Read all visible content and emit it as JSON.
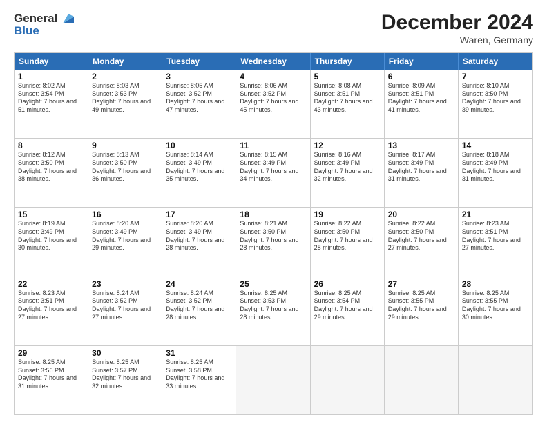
{
  "logo": {
    "line1": "General",
    "line2": "Blue"
  },
  "title": "December 2024",
  "location": "Waren, Germany",
  "header": {
    "days": [
      "Sunday",
      "Monday",
      "Tuesday",
      "Wednesday",
      "Thursday",
      "Friday",
      "Saturday"
    ]
  },
  "weeks": [
    [
      {
        "day": "1",
        "sunrise": "8:02 AM",
        "sunset": "3:54 PM",
        "daylight": "7 hours and 51 minutes."
      },
      {
        "day": "2",
        "sunrise": "8:03 AM",
        "sunset": "3:53 PM",
        "daylight": "7 hours and 49 minutes."
      },
      {
        "day": "3",
        "sunrise": "8:05 AM",
        "sunset": "3:52 PM",
        "daylight": "7 hours and 47 minutes."
      },
      {
        "day": "4",
        "sunrise": "8:06 AM",
        "sunset": "3:52 PM",
        "daylight": "7 hours and 45 minutes."
      },
      {
        "day": "5",
        "sunrise": "8:08 AM",
        "sunset": "3:51 PM",
        "daylight": "7 hours and 43 minutes."
      },
      {
        "day": "6",
        "sunrise": "8:09 AM",
        "sunset": "3:51 PM",
        "daylight": "7 hours and 41 minutes."
      },
      {
        "day": "7",
        "sunrise": "8:10 AM",
        "sunset": "3:50 PM",
        "daylight": "7 hours and 39 minutes."
      }
    ],
    [
      {
        "day": "8",
        "sunrise": "8:12 AM",
        "sunset": "3:50 PM",
        "daylight": "7 hours and 38 minutes."
      },
      {
        "day": "9",
        "sunrise": "8:13 AM",
        "sunset": "3:50 PM",
        "daylight": "7 hours and 36 minutes."
      },
      {
        "day": "10",
        "sunrise": "8:14 AM",
        "sunset": "3:49 PM",
        "daylight": "7 hours and 35 minutes."
      },
      {
        "day": "11",
        "sunrise": "8:15 AM",
        "sunset": "3:49 PM",
        "daylight": "7 hours and 34 minutes."
      },
      {
        "day": "12",
        "sunrise": "8:16 AM",
        "sunset": "3:49 PM",
        "daylight": "7 hours and 32 minutes."
      },
      {
        "day": "13",
        "sunrise": "8:17 AM",
        "sunset": "3:49 PM",
        "daylight": "7 hours and 31 minutes."
      },
      {
        "day": "14",
        "sunrise": "8:18 AM",
        "sunset": "3:49 PM",
        "daylight": "7 hours and 31 minutes."
      }
    ],
    [
      {
        "day": "15",
        "sunrise": "8:19 AM",
        "sunset": "3:49 PM",
        "daylight": "7 hours and 30 minutes."
      },
      {
        "day": "16",
        "sunrise": "8:20 AM",
        "sunset": "3:49 PM",
        "daylight": "7 hours and 29 minutes."
      },
      {
        "day": "17",
        "sunrise": "8:20 AM",
        "sunset": "3:49 PM",
        "daylight": "7 hours and 28 minutes."
      },
      {
        "day": "18",
        "sunrise": "8:21 AM",
        "sunset": "3:50 PM",
        "daylight": "7 hours and 28 minutes."
      },
      {
        "day": "19",
        "sunrise": "8:22 AM",
        "sunset": "3:50 PM",
        "daylight": "7 hours and 28 minutes."
      },
      {
        "day": "20",
        "sunrise": "8:22 AM",
        "sunset": "3:50 PM",
        "daylight": "7 hours and 27 minutes."
      },
      {
        "day": "21",
        "sunrise": "8:23 AM",
        "sunset": "3:51 PM",
        "daylight": "7 hours and 27 minutes."
      }
    ],
    [
      {
        "day": "22",
        "sunrise": "8:23 AM",
        "sunset": "3:51 PM",
        "daylight": "7 hours and 27 minutes."
      },
      {
        "day": "23",
        "sunrise": "8:24 AM",
        "sunset": "3:52 PM",
        "daylight": "7 hours and 27 minutes."
      },
      {
        "day": "24",
        "sunrise": "8:24 AM",
        "sunset": "3:52 PM",
        "daylight": "7 hours and 28 minutes."
      },
      {
        "day": "25",
        "sunrise": "8:25 AM",
        "sunset": "3:53 PM",
        "daylight": "7 hours and 28 minutes."
      },
      {
        "day": "26",
        "sunrise": "8:25 AM",
        "sunset": "3:54 PM",
        "daylight": "7 hours and 29 minutes."
      },
      {
        "day": "27",
        "sunrise": "8:25 AM",
        "sunset": "3:55 PM",
        "daylight": "7 hours and 29 minutes."
      },
      {
        "day": "28",
        "sunrise": "8:25 AM",
        "sunset": "3:55 PM",
        "daylight": "7 hours and 30 minutes."
      }
    ],
    [
      {
        "day": "29",
        "sunrise": "8:25 AM",
        "sunset": "3:56 PM",
        "daylight": "7 hours and 31 minutes."
      },
      {
        "day": "30",
        "sunrise": "8:25 AM",
        "sunset": "3:57 PM",
        "daylight": "7 hours and 32 minutes."
      },
      {
        "day": "31",
        "sunrise": "8:25 AM",
        "sunset": "3:58 PM",
        "daylight": "7 hours and 33 minutes."
      },
      null,
      null,
      null,
      null
    ]
  ]
}
